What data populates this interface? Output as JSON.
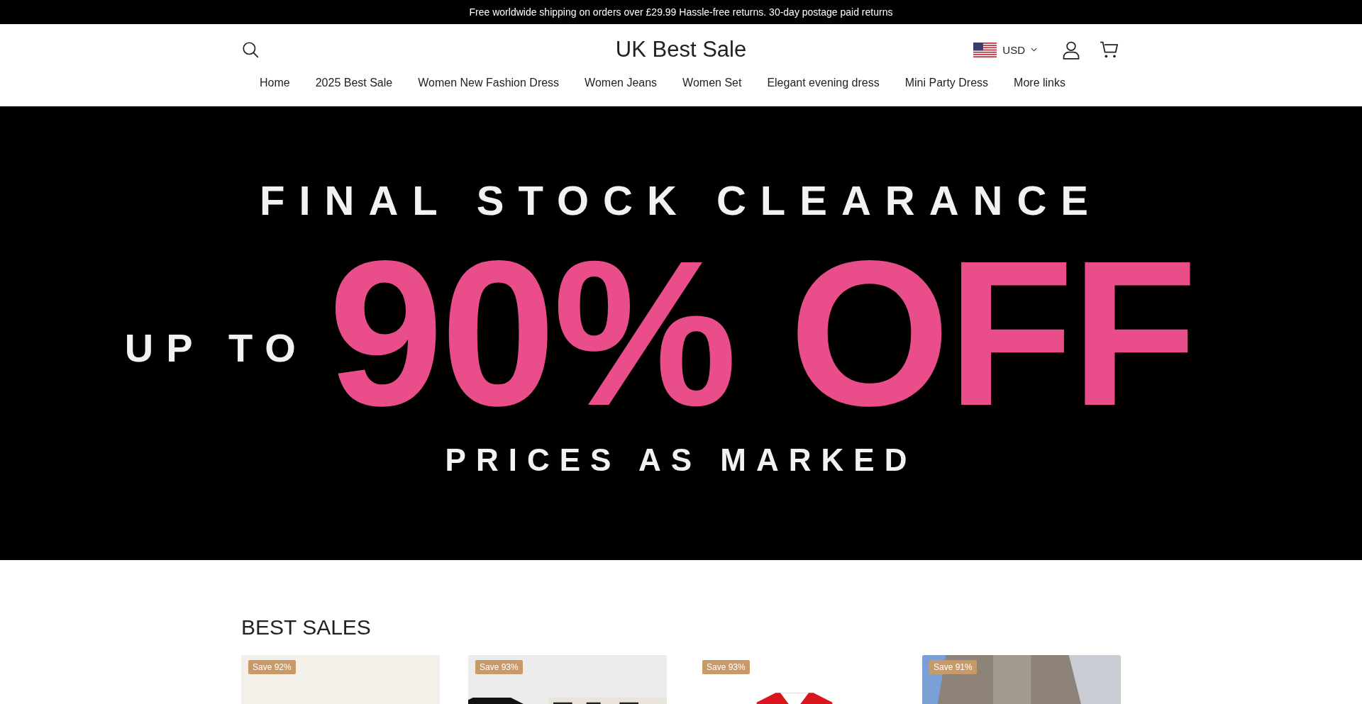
{
  "announcement": "Free worldwide shipping on orders over £29.99 Hassle-free returns. 30-day postage paid returns",
  "header": {
    "logo": "UK Best Sale",
    "currency": "USD"
  },
  "nav": [
    {
      "label": "Home"
    },
    {
      "label": "2025 Best Sale"
    },
    {
      "label": "Women New Fashion Dress"
    },
    {
      "label": "Women Jeans"
    },
    {
      "label": "Women Set"
    },
    {
      "label": "Elegant evening dress"
    },
    {
      "label": "Mini Party Dress"
    },
    {
      "label": "More links"
    }
  ],
  "hero": {
    "headline": "FINAL STOCK CLEARANCE",
    "prefix": "UP TO",
    "offer": "90% OFF",
    "subline": "PRICES AS MARKED"
  },
  "section_title": "BEST SALES",
  "products": [
    {
      "badge": "Save 92%",
      "kind": "picture"
    },
    {
      "badge": "Save 93%",
      "kind": "picture"
    },
    {
      "badge": "Save 93%",
      "kind": "picture"
    },
    {
      "badge": "Save 91%",
      "kind": "picture"
    }
  ]
}
